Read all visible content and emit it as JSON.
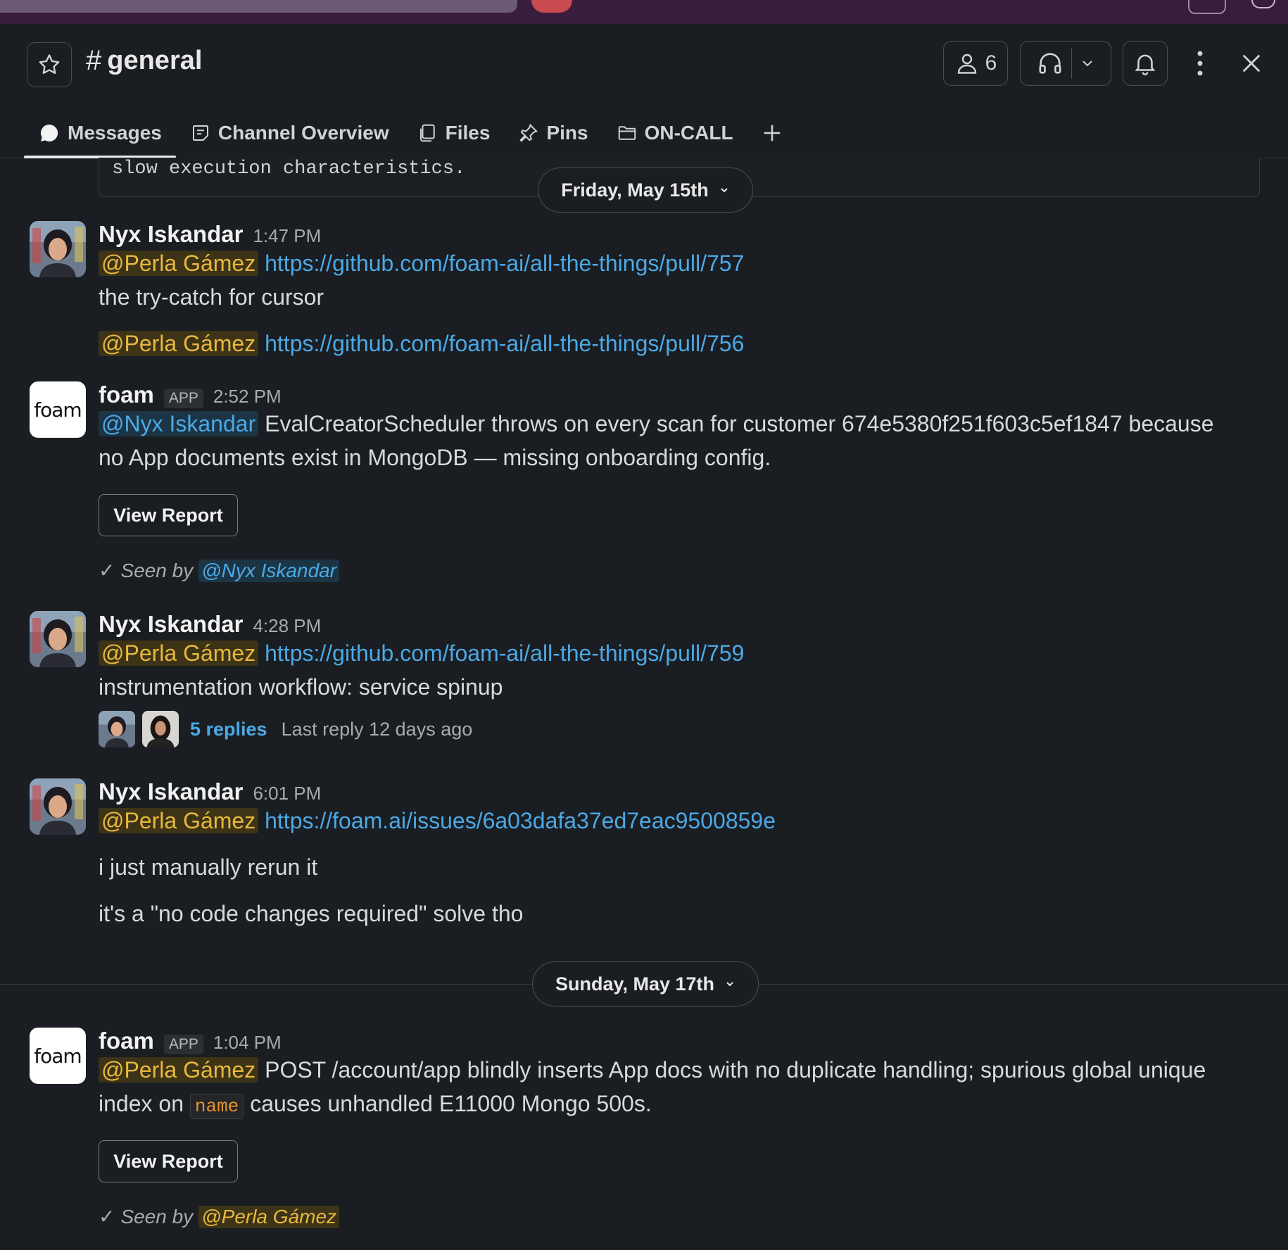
{
  "channel": {
    "hash": "#",
    "name": "general",
    "member_count": "6"
  },
  "tabs": [
    {
      "label": "Messages",
      "icon": "chat-bubble-icon"
    },
    {
      "label": "Channel Overview",
      "icon": "overview-icon"
    },
    {
      "label": "Files",
      "icon": "files-icon"
    },
    {
      "label": "Pins",
      "icon": "pin-icon"
    },
    {
      "label": "ON-CALL",
      "icon": "folder-icon"
    }
  ],
  "code_snippet": "slow execution characteristics.",
  "dates": {
    "first": "Friday, May 15th",
    "second": "Sunday, May 17th"
  },
  "messages": [
    {
      "author": "Nyx Iskandar",
      "time": "1:47 PM",
      "mention1": "@Perla Gámez",
      "link1": "https://github.com/foam-ai/all-the-things/pull/757",
      "text": "the try-catch for cursor",
      "mention2": "@Perla Gámez",
      "link2": "https://github.com/foam-ai/all-the-things/pull/756"
    },
    {
      "author": "foam",
      "tag": "APP",
      "time": "2:52 PM",
      "mention": "@Nyx Iskandar",
      "text1": " EvalCreatorScheduler throws on every scan for customer 674e5380f251f603c5ef1847 because",
      "text2": "no App documents exist in MongoDB — missing onboarding config.",
      "button": "View Report",
      "seen_prefix": "Seen by",
      "seen_mention": "@Nyx Iskandar"
    },
    {
      "author": "Nyx Iskandar",
      "time": "4:28 PM",
      "mention": "@Perla Gámez",
      "link": "https://github.com/foam-ai/all-the-things/pull/759",
      "text": "instrumentation workflow: service spinup",
      "replies": "5 replies",
      "last_reply": "Last reply 12 days ago"
    },
    {
      "author": "Nyx Iskandar",
      "time": "6:01 PM",
      "mention": "@Perla Gámez",
      "link": "https://foam.ai/issues/6a03dafa37ed7eac9500859e",
      "text1": "i just manually rerun it",
      "text2": "it's a \"no code changes required\" solve tho"
    },
    {
      "author": "foam",
      "tag": "APP",
      "time": "1:04 PM",
      "mention": "@Perla Gámez",
      "text1": " POST /account/app blindly inserts App docs with no duplicate handling; spurious global unique",
      "text2a": "index on ",
      "code": "name",
      "text2b": " causes unhandled E11000 Mongo 500s.",
      "button": "View Report",
      "seen_prefix": "Seen by",
      "seen_mention": "@Perla Gámez"
    }
  ],
  "colors": {
    "background": "#1a1d21",
    "link": "#4ba9e6",
    "mention": "#e8b83d",
    "topbar": "#3a1c3f"
  }
}
